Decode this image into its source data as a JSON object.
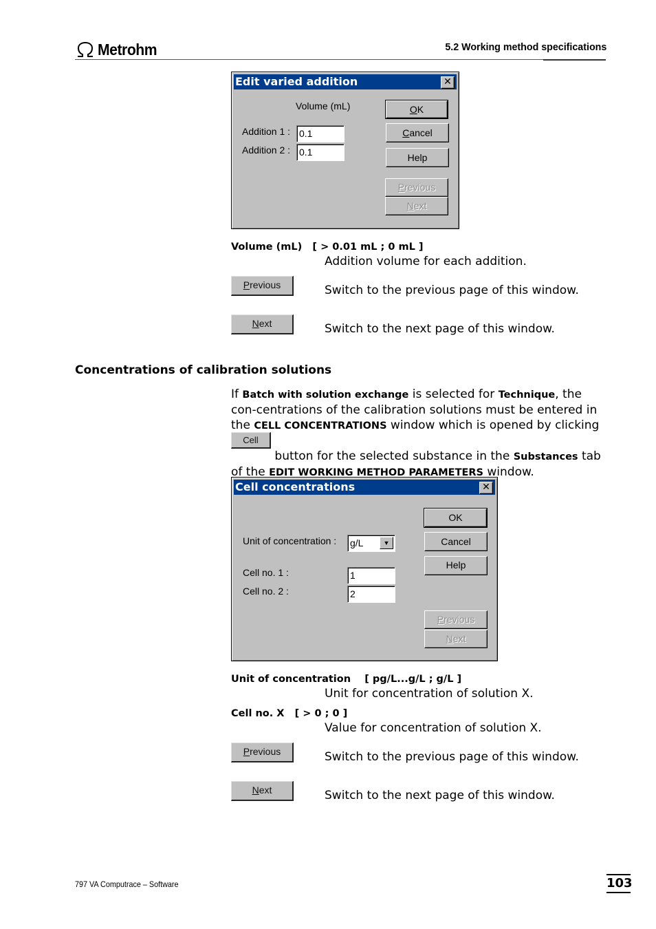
{
  "header": {
    "brand": "Metrohm",
    "section_title": "5.2  Working method specifications"
  },
  "dialog1": {
    "title": "Edit varied addition",
    "column_label": "Volume (mL)",
    "fields": [
      {
        "label": "Addition 1 :",
        "value": "0.1"
      },
      {
        "label": "Addition 2 :",
        "value": "0.1"
      }
    ],
    "buttons": {
      "ok": {
        "pre": "",
        "ul": "O",
        "post": "K"
      },
      "cancel": {
        "pre": "",
        "ul": "C",
        "post": "ancel"
      },
      "help": "Help",
      "previous": {
        "pre": "",
        "ul": "P",
        "post": "revious"
      },
      "next": {
        "pre": "",
        "ul": "N",
        "post": "ext"
      }
    }
  },
  "params1": {
    "volume_label": "Volume (mL)   [ > 0.01 mL ; 0 mL ]",
    "volume_desc": "Addition volume for each addition.",
    "previous_btn": {
      "ul": "P",
      "post": "revious"
    },
    "previous_desc": "Switch to the previous page of this window.",
    "next_btn": {
      "ul": "N",
      "post": "ext"
    },
    "next_desc": "Switch to the next page of this window."
  },
  "section": {
    "heading": "Concentrations of calibration solutions",
    "para": {
      "t1": "If ",
      "b1": "Batch with solution exchange",
      "t2": " is selected for ",
      "b2": "Technique",
      "t3": ", the con-centrations of the calibration solutions must be entered in the ",
      "b3": "CELL CONCENTRATIONS",
      "t4": " window which is opened by clicking the",
      "cell_btn": "Cell",
      "t5": " button for the selected substance in the ",
      "b4": "Substances",
      "t6": " tab of the ",
      "b5": "EDIT WORKING METHOD PARAMETERS",
      "t7": " window."
    }
  },
  "dialog2": {
    "title": "Cell concentrations",
    "unit_label": "Unit of concentration :",
    "unit_value": "g/L",
    "fields": [
      {
        "label": "Cell no. 1 :",
        "value": "1"
      },
      {
        "label": "Cell no. 2 :",
        "value": "2"
      }
    ],
    "buttons": {
      "ok": "OK",
      "cancel": "Cancel",
      "help": "Help",
      "previous": {
        "ul": "P",
        "post": "revious"
      },
      "next": {
        "ul": "N",
        "post": "ext"
      }
    }
  },
  "params2": {
    "unit_label": "Unit of concentration    [ pg/L...g/L ; g/L ]",
    "unit_desc": "Unit for concentration of solution X.",
    "cell_label": "Cell no. X   [ > 0 ; 0 ]",
    "cell_desc": "Value for concentration of solution X.",
    "previous_btn": {
      "ul": "P",
      "post": "revious"
    },
    "previous_desc": "Switch to the previous page of this window.",
    "next_btn": {
      "ul": "N",
      "post": "ext"
    },
    "next_desc": "Switch to the next page of this window."
  },
  "footer": {
    "product": "797 VA Computrace – Software",
    "page_number": "103"
  }
}
